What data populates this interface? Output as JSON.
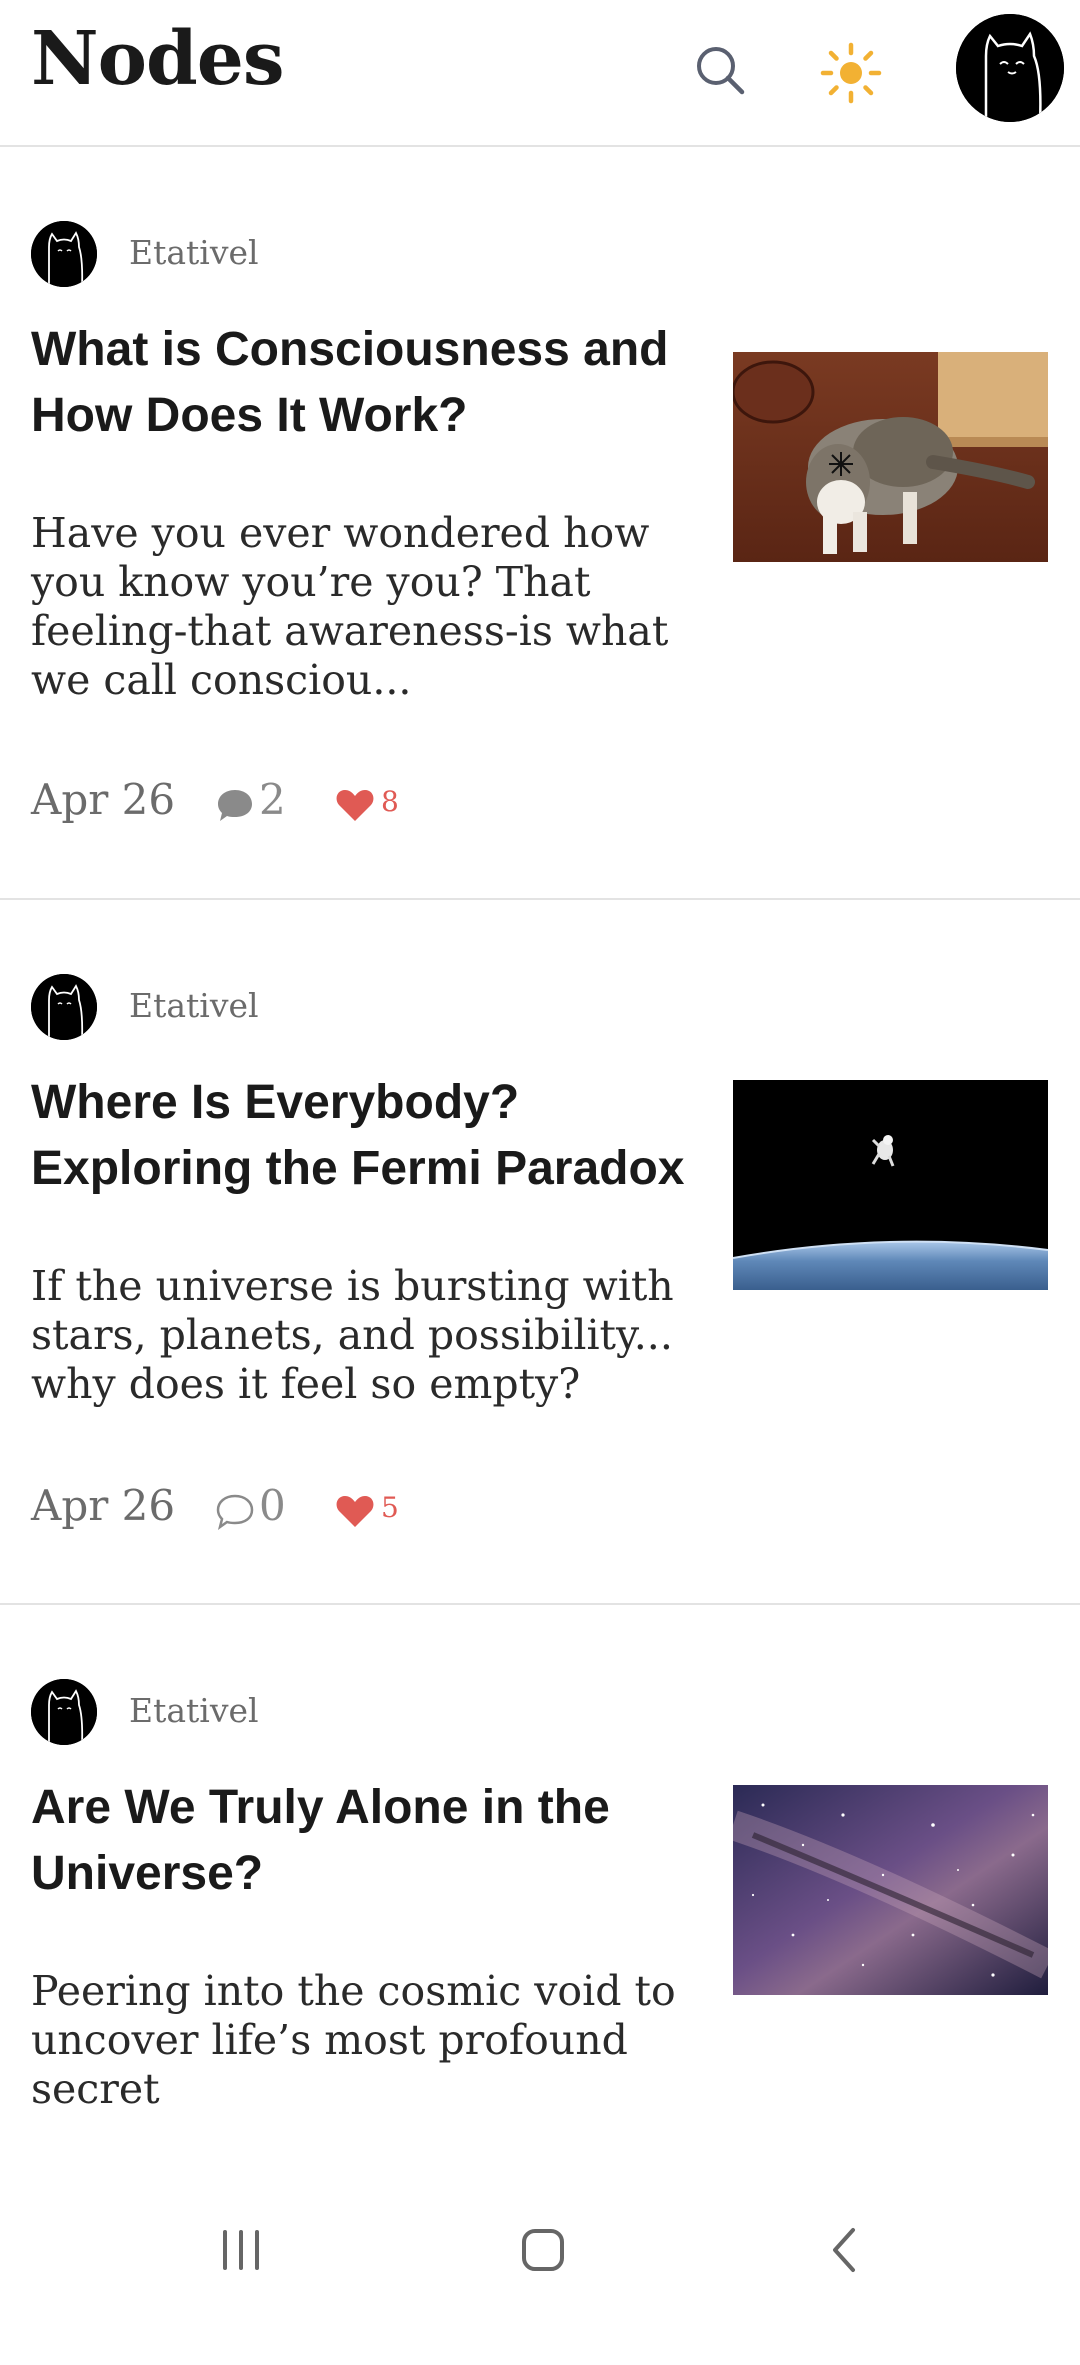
{
  "app": {
    "title": "Nodes"
  },
  "header": {
    "icons": {
      "search": "search-icon",
      "theme": "sun-icon",
      "profile": "profile-avatar"
    },
    "colors": {
      "sun": "#f2b133",
      "search": "#5a6070"
    }
  },
  "posts": [
    {
      "author": "Etativel",
      "title": "What is Consciousness and How Does It Work?",
      "excerpt": "Have you ever wondered how you know you’re you? That feeling-that awareness-is what we call consciou...",
      "date": "Apr 26",
      "comments": "2",
      "likes": "8",
      "thumbnail": "cat-photo",
      "comment_icon": "filled"
    },
    {
      "author": "Etativel",
      "title": "Where Is Everybody? Exploring the Fermi Paradox",
      "excerpt": "If the universe is bursting with stars, planets, and possibility... why does it feel so empty?",
      "date": "Apr 26",
      "comments": "0",
      "likes": "5",
      "thumbnail": "astronaut-over-earth-photo",
      "comment_icon": "outline"
    },
    {
      "author": "Etativel",
      "title": "Are We Truly Alone in the Universe?",
      "excerpt": "Peering into the cosmic void to uncover life’s most profound secret",
      "thumbnail": "milky-way-photo"
    }
  ],
  "colors": {
    "heart": "#e05a54",
    "divider": "#e3e3e3",
    "meta": "#6b6b6b"
  },
  "nav_bar": {
    "icons": [
      "recent-apps-icon",
      "home-icon",
      "back-icon"
    ]
  }
}
